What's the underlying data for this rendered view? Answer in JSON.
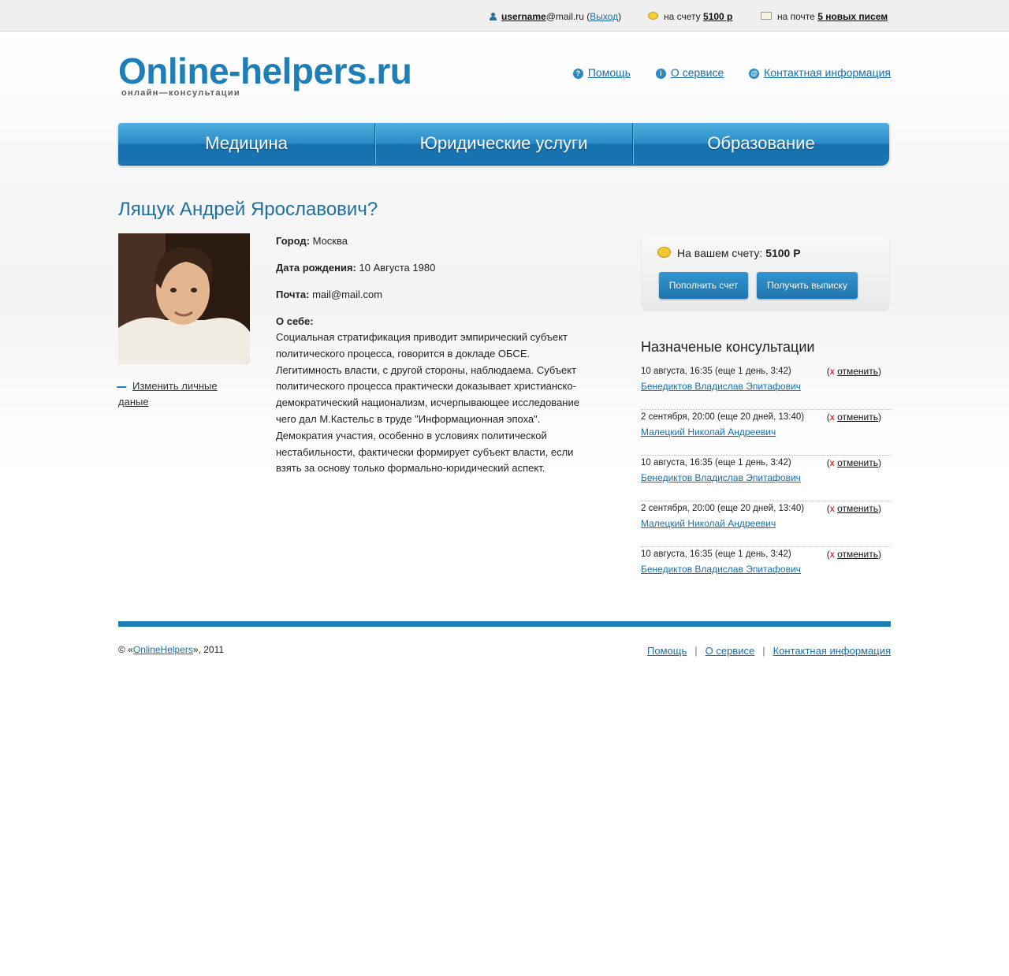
{
  "topbar": {
    "username": "username",
    "domain": "@mail.ru",
    "logout_label": "Выход",
    "balance_prefix": "на счету",
    "balance_value": "5100 р",
    "mail_prefix": "на почте",
    "mail_value": "5 новых писем"
  },
  "header": {
    "logo_title": "Online-helpers.ru",
    "logo_subtitle": "онлайн—консультации",
    "links": {
      "help": "Помощь",
      "about": "О сервисе",
      "contacts": "Контактная информация"
    },
    "help_glyph": "?",
    "about_glyph": "i",
    "contacts_glyph": "@"
  },
  "nav": {
    "items": [
      "Медицина",
      "Юридические услуги",
      "Образование"
    ]
  },
  "profile": {
    "title": "Лящук Андрей Ярославович?",
    "edit_label": "Изменить личные даные",
    "city_label": "Город:",
    "city": "Москва",
    "birth_label": "Дата рождения:",
    "birth": "10 Августа 1980",
    "mail_label": "Почта:",
    "mail": "mail@mail.com",
    "about_label": "О себе:",
    "about_text": "Социальная стратификация приводит эмпирический субъект политического процесса, говорится в докладе ОБСЕ. Легитимность власти, с другой стороны, наблюдаема. Субъект политического процесса практически доказывает христианско-демократический национализм, исчерпывающее исследование чего дал М.Кастельс в труде \"Информационная эпоха\". Демократия участия, особенно в условиях политической нестабильности, фактически формирует субъект власти, если взять за основу только формально-юридический аспект."
  },
  "balance": {
    "label": "На вашем счету:",
    "value": "5100 Р",
    "topup_button": "Пополнить счет",
    "statement_button": "Получить выписку"
  },
  "consultations": {
    "title": "Назначеные консультации",
    "cancel_x": "х",
    "cancel_label": "отменить",
    "items": [
      {
        "date": "10 августа, 16:35",
        "remaining": "(еще 1 день, 3:42)",
        "name": "Бенедиктов Владислав Эпитафович"
      },
      {
        "date": "2 сентября, 20:00",
        "remaining": "(еще 20 дней, 13:40)",
        "name": "Малецкий Николай Андреевич"
      },
      {
        "date": "10 августа, 16:35",
        "remaining": "(еще 1 день, 3:42)",
        "name": "Бенедиктов Владислав Эпитафович"
      },
      {
        "date": "2 сентября, 20:00",
        "remaining": "(еще 20 дней, 13:40)",
        "name": "Малецкий Николай Андреевич"
      },
      {
        "date": "10 августа, 16:35",
        "remaining": "(еще 1 день, 3:42)",
        "name": "Бенедиктов Владислав Эпитафович"
      }
    ]
  },
  "footer": {
    "copyright_prefix": "© «",
    "copyright_link": "OnlineHelpers",
    "copyright_suffix": "», 2011",
    "links": {
      "help": "Помощь",
      "about": "О сервисе",
      "contacts": "Контактная информация"
    },
    "separator": "|"
  },
  "colors": {
    "brand_blue": "#1e7fb8",
    "link_blue": "#1b6ea8",
    "cancel_red": "#cc0000"
  }
}
